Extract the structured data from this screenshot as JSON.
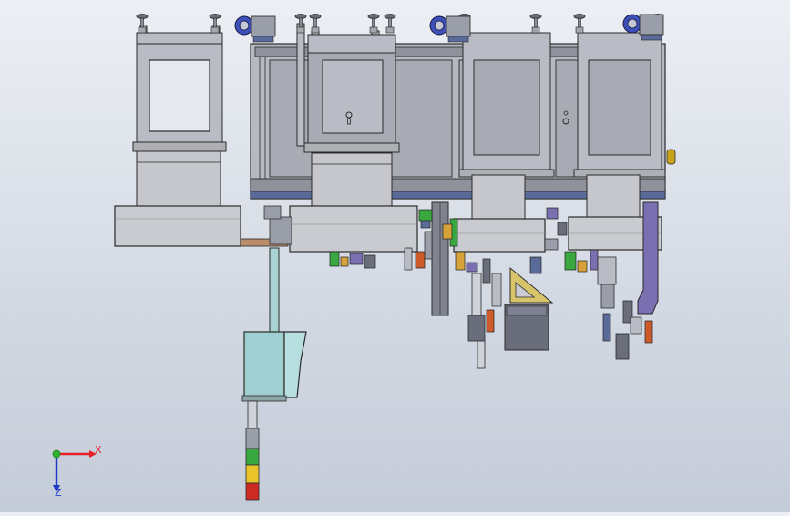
{
  "triad": {
    "x_label": "X",
    "z_label": "Z",
    "x_color": "#e8202a",
    "y_color": "#2fb52f",
    "z_color": "#2038c8"
  },
  "colors": {
    "frame_fill": "#b9bcc4",
    "frame_panel": "#9ea1a9",
    "drum_fill": "#c5c7cc",
    "base_plate": "#aeb0b6",
    "duct": "#a9d2d3",
    "box": "#9fcfd0",
    "dark_block": "#6a6e7b",
    "purple_rail": "#7a6fb0",
    "tower_green": "#3aa840",
    "tower_yellow": "#e8c42a",
    "tower_red": "#cc2a22",
    "edge": "#2a2a2a"
  },
  "icons": {
    "triad": "coordinate-triad-icon",
    "tower": "signal-tower-icon",
    "knob": "adjuster-knob-icon",
    "lock": "keyhole-icon"
  }
}
